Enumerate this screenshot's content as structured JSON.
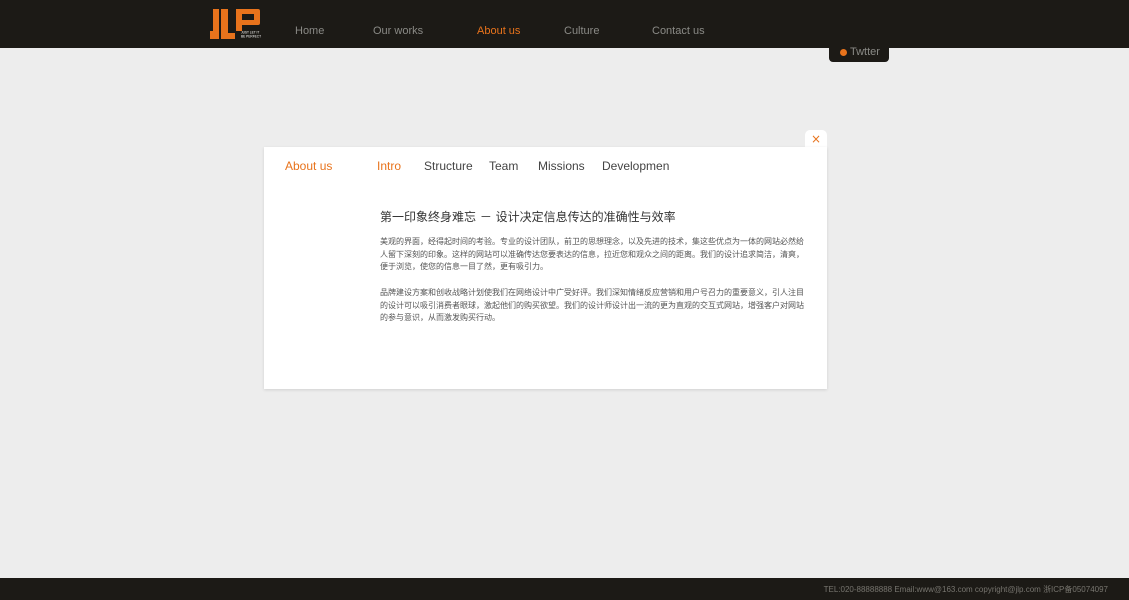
{
  "brand": {
    "logo_text": "JLP",
    "logo_tagline": "JUST LET IT BE PERFECT",
    "accent_color": "#e8731c",
    "bar_color": "#1c1a16"
  },
  "nav": {
    "items": [
      {
        "label": "Home"
      },
      {
        "label": "Our works"
      },
      {
        "label": "About us",
        "active": true
      },
      {
        "label": "Culture"
      },
      {
        "label": "Contact us"
      }
    ]
  },
  "twitter": {
    "label": "Twtter"
  },
  "panel": {
    "close_icon": "close-icon",
    "close_label": "×",
    "title": "About us",
    "tabs": [
      {
        "label": "Intro",
        "active": true
      },
      {
        "label": "Structure"
      },
      {
        "label": "Team"
      },
      {
        "label": "Missions"
      },
      {
        "label": "Developmen"
      }
    ],
    "heading": "第一印象终身难忘 － 设计决定信息传达的准确性与效率",
    "paragraphs": [
      "美观的界面，经得起时间的考验。专业的设计团队，前卫的思想理念，以及先进的技术，集这些优点为一体的网站必然给人留下深刻的印象。这样的网站可以准确传达您要表达的信息，拉近您和观众之间的距离。我们的设计追求简洁，清爽，便于浏览，使您的信息一目了然，更有吸引力。",
      "品牌建设方案和创收战略计划使我们在网络设计中广受好评。我们深知情绪反应营销和用户号召力的重要意义，引人注目的设计可以吸引消费者眼球，激起他们的购买欲望。我们的设计师设计出一流的更为直观的交互式网站，增强客户对网站的参与意识，从而激发购买行动。"
    ]
  },
  "footer": {
    "text": "TEL:020-88888888    Email:www@163.com  copyright@jlp.com    浙ICP备05074097"
  }
}
